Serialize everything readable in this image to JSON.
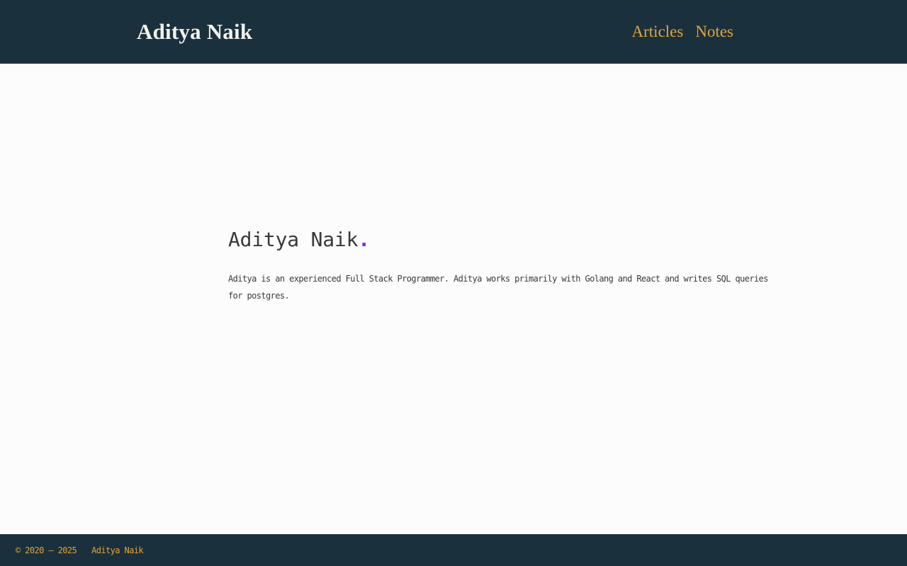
{
  "header": {
    "logo": "Aditya Naik",
    "nav": [
      {
        "label": "Articles"
      },
      {
        "label": "Notes"
      }
    ]
  },
  "hero": {
    "title": "Aditya Naik",
    "title_accent": ".",
    "description": "Aditya is an experienced Full Stack Programmer. Aditya works primarily with Golang and React and writes SQL queries for postgres."
  },
  "footer": {
    "copyright": "© 2020 – 2025",
    "owner": "Aditya Naik"
  },
  "colors": {
    "header_bg": "#1a313d",
    "page_bg": "#fcfcfc",
    "accent_gold": "#e0a33d",
    "accent_purple": "#8e26ef",
    "text_dark": "#3a3a3a",
    "logo_white": "#f2f1ec"
  }
}
